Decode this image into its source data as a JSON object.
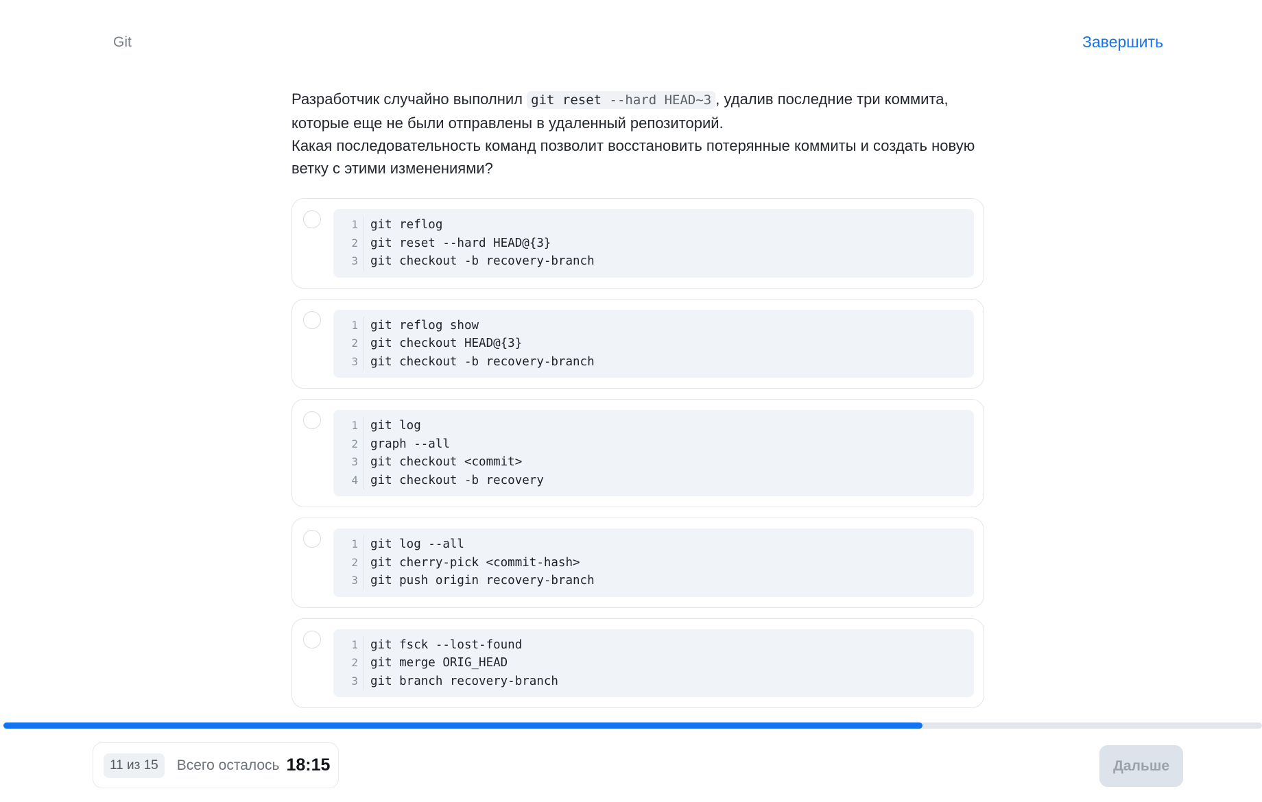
{
  "header": {
    "topic": "Git",
    "finish_label": "Завершить"
  },
  "question": {
    "text_before": "Разработчик случайно выполнил ",
    "code_cmd": "git reset",
    "code_args": " --hard HEAD~3",
    "text_after": ", удалив последние три коммита, которые еще не были отправлены в удаленный репозиторий.",
    "text_second": "Какая последовательность команд позволит восстановить потерянные коммиты и создать новую ветку с этими изменениями?"
  },
  "options": [
    {
      "lines": [
        {
          "n": "1",
          "code": "git reflog"
        },
        {
          "n": "2",
          "code": "git reset --hard HEAD@{3}"
        },
        {
          "n": "3",
          "code": "git checkout -b recovery-branch"
        }
      ]
    },
    {
      "lines": [
        {
          "n": "1",
          "code": "git reflog show"
        },
        {
          "n": "2",
          "code": "git checkout HEAD@{3}"
        },
        {
          "n": "3",
          "code": "git checkout -b recovery-branch"
        }
      ]
    },
    {
      "lines": [
        {
          "n": "1",
          "code": "git log"
        },
        {
          "n": "2",
          "code": "graph --all"
        },
        {
          "n": "3",
          "code": "git checkout <commit>"
        },
        {
          "n": "4",
          "code": "git checkout -b recovery"
        }
      ]
    },
    {
      "lines": [
        {
          "n": "1",
          "code": "git log --all"
        },
        {
          "n": "2",
          "code": "git cherry-pick <commit-hash>"
        },
        {
          "n": "3",
          "code": "git push origin recovery-branch"
        }
      ]
    },
    {
      "lines": [
        {
          "n": "1",
          "code": "git fsck --lost-found"
        },
        {
          "n": "2",
          "code": "git merge ORIG_HEAD"
        },
        {
          "n": "3",
          "code": "git branch recovery-branch"
        }
      ]
    }
  ],
  "progress": {
    "fraction": 0.73
  },
  "footer": {
    "counter": "11 из 15",
    "remaining_label": "Всего осталось",
    "timer": "18:15",
    "next_label": "Дальше"
  }
}
